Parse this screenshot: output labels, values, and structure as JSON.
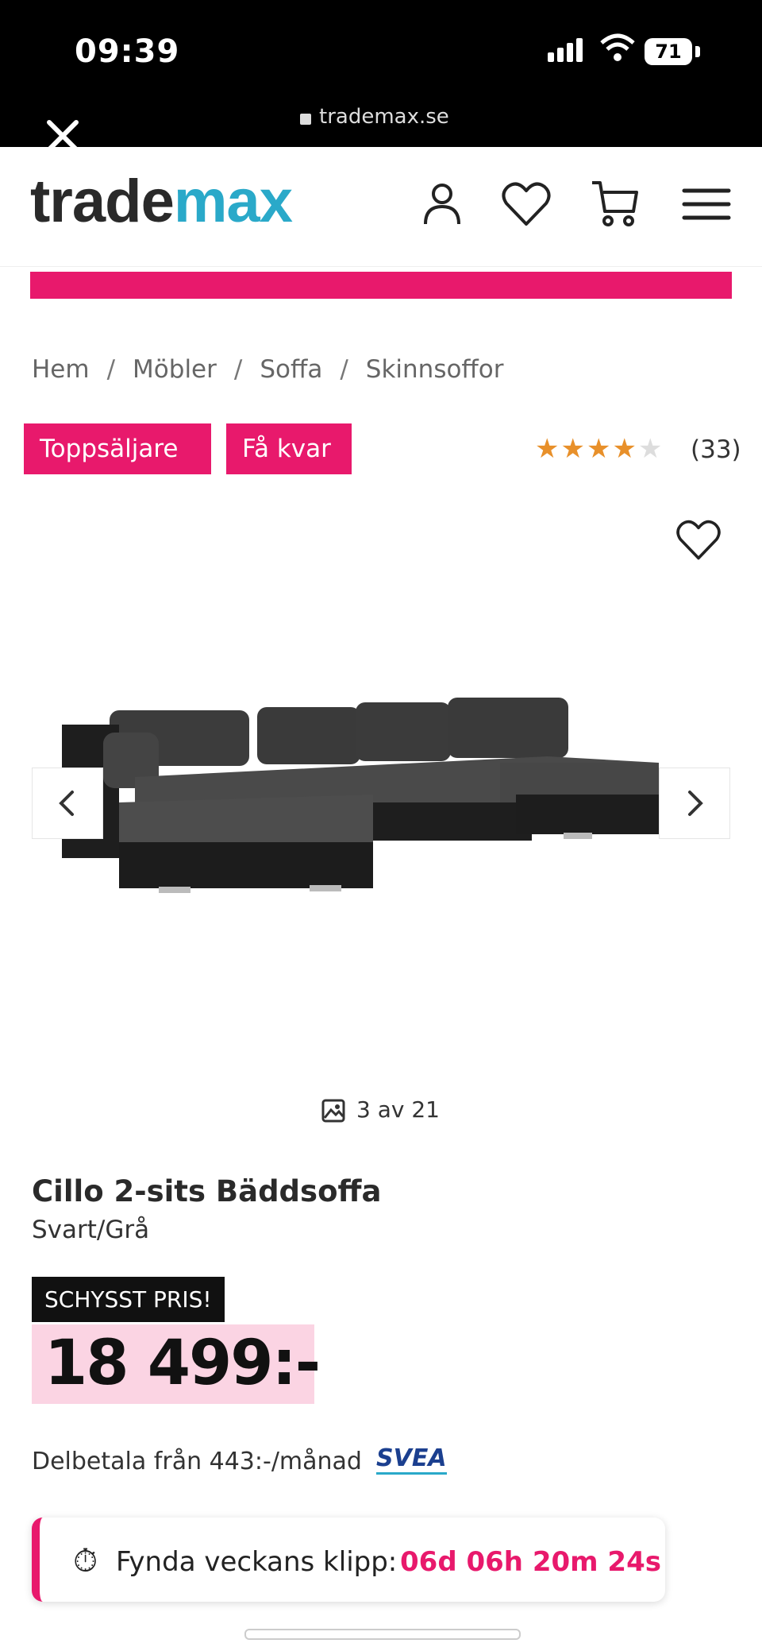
{
  "status_bar": {
    "time": "09:39",
    "battery": "71"
  },
  "browser": {
    "url": "trademax.se"
  },
  "header": {
    "logo_part1": "trade",
    "logo_part2": "max"
  },
  "breadcrumb": [
    "Hem",
    "Möbler",
    "Soffa",
    "Skinnsoffor"
  ],
  "badges": {
    "top_seller": "Toppsäljare",
    "few_left": "Få kvar"
  },
  "rating": {
    "stars": 4,
    "max": 5,
    "count": "(33)"
  },
  "gallery": {
    "counter": "3 av 21"
  },
  "product": {
    "title": "Cillo 2-sits Bäddsoffa",
    "variant": "Svart/Grå",
    "price_label": "SCHYSST PRIS!",
    "price": "18 499:-",
    "installment": "Delbetala från 443:-/månad",
    "installment_provider": "SVEA"
  },
  "deal": {
    "label": "Fynda veckans klipp:",
    "timer": "06d 06h 20m 24s"
  },
  "colors": {
    "accent": "#e8196c",
    "logo_teal": "#2aa9c9",
    "price_bg": "#fbd4e3"
  },
  "icons": [
    "close-icon",
    "user-icon",
    "heart-icon",
    "cart-icon",
    "menu-icon",
    "chevron-left-icon",
    "chevron-right-icon",
    "image-icon",
    "stopwatch-icon"
  ]
}
